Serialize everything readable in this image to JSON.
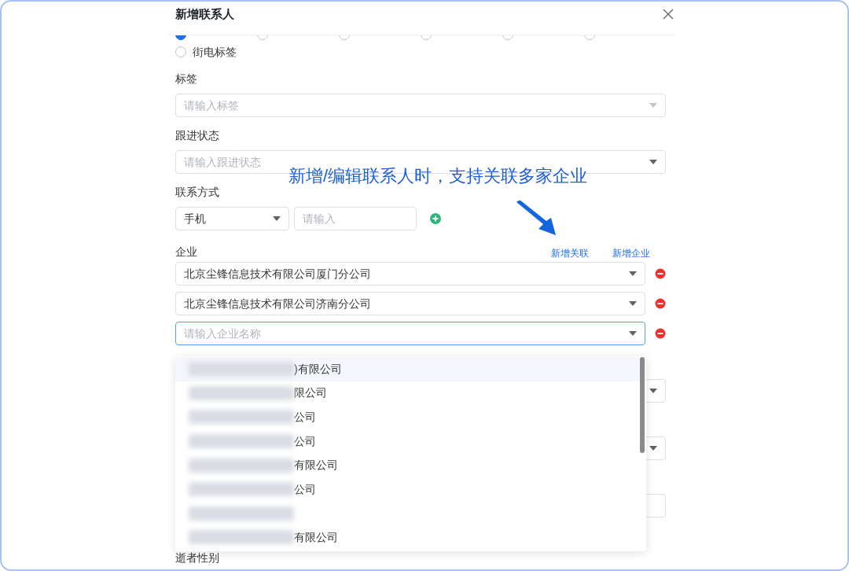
{
  "dialog": {
    "title": "新增联系人"
  },
  "radios": [
    {
      "selected": true
    },
    {
      "selected": false
    },
    {
      "selected": false
    },
    {
      "selected": false
    },
    {
      "selected": false
    },
    {
      "selected": false
    }
  ],
  "radios_row2": [
    {
      "label": "街电标签",
      "selected": false
    }
  ],
  "fields": [
    {
      "label": "标签",
      "placeholder": "请输入标签",
      "arrow_muted": true
    },
    {
      "label": "跟进状态",
      "placeholder": "请输入跟进状态",
      "arrow_muted": false
    }
  ],
  "contact": {
    "label": "联系方式",
    "type_value": "手机",
    "placeholder": "请输入"
  },
  "annotation": {
    "text": "新增/编辑联系人时，支持关联多家企业"
  },
  "enterprise": {
    "label": "企业",
    "links": [
      "新增关联",
      "新增企业"
    ],
    "rows": [
      {
        "value": "北京尘锋信息技术有限公司厦门分公司",
        "focused": false
      },
      {
        "value": "北京尘锋信息技术有限公司济南分公司",
        "focused": false
      },
      {
        "placeholder": "请输入企业名称",
        "focused": true
      }
    ]
  },
  "hidden_rows": [
    {
      "kind": "select"
    },
    {
      "kind": "select"
    },
    {
      "kind": "input"
    }
  ],
  "dropdown": {
    "options": [
      {
        "text": ")有限公司",
        "highlighted": true
      },
      {
        "text": "限公司",
        "highlighted": false
      },
      {
        "text": "公司",
        "highlighted": false
      },
      {
        "text": "公司",
        "highlighted": false
      },
      {
        "text": "有限公司",
        "highlighted": false
      },
      {
        "text": "公司",
        "highlighted": false
      },
      {
        "highlighted": false
      },
      {
        "text": "有限公司",
        "highlighted": false
      }
    ]
  },
  "bottom_label": "逝者性别"
}
